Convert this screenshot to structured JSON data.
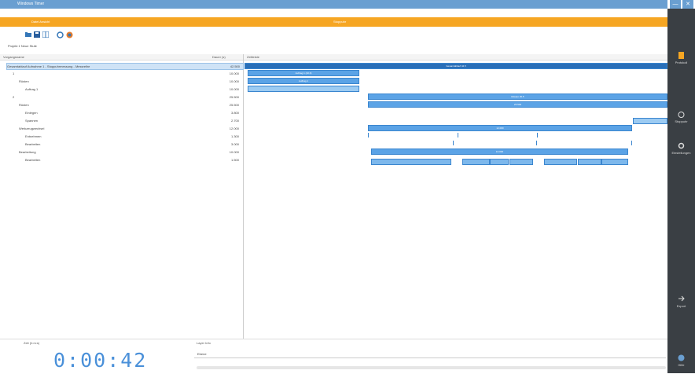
{
  "window": {
    "title": "Windows Timer",
    "minimize": "—",
    "close": "✕"
  },
  "menu": {
    "left": "Datei   Ansicht",
    "center": "Stoppuhr"
  },
  "toolbar": {
    "icons": [
      "open-icon",
      "save-icon",
      "grid-icon",
      "refresh-icon",
      "globe-icon"
    ]
  },
  "breadcrumb": "Projekt 1   Neue Stufe",
  "columns": {
    "name": "Vorgangsname",
    "duration": "Dauer (s)",
    "timeline": "Zeitleiste"
  },
  "rows": [
    {
      "name": "Gesamtablauf Aufnahme 1 - Stoppuhrmessung - Messreihe",
      "val": "42.500",
      "indent": 0,
      "selected": true
    },
    {
      "name": "1",
      "val": "10.000",
      "indent": 1
    },
    {
      "name": "Rüsten",
      "val": "10.000",
      "indent": 2
    },
    {
      "name": "Auftrag 1",
      "val": "10.000",
      "indent": 3
    },
    {
      "name": "2",
      "val": "25.500",
      "indent": 1
    },
    {
      "name": "Rüsten",
      "val": "25.500",
      "indent": 2
    },
    {
      "name": "Einlegen",
      "val": "3.800",
      "indent": 3
    },
    {
      "name": "Spannen",
      "val": "2.700",
      "indent": 3
    },
    {
      "name": "Werkzeugwechsel",
      "val": "12.000",
      "indent": 2
    },
    {
      "name": "Entnehmen",
      "val": "1.300",
      "indent": 3
    },
    {
      "name": "Bearbeiten",
      "val": "3.000",
      "indent": 3
    },
    {
      "name": "Bearbeitung",
      "val": "10.000",
      "indent": 2
    },
    {
      "name": "Bearbeiten",
      "val": "1.500",
      "indent": 3
    }
  ],
  "timeline": {
    "top_bar": "Gesamtablauf 42.5",
    "bars": [
      "Auftrag 1 (10.0)",
      "Auftrag 1",
      "Rüsten 25.5",
      "25.500",
      "12.000",
      "10.000"
    ]
  },
  "bottom": {
    "timer_label": "Zeit (h:m:s)",
    "timer": "0:00:42",
    "layer_label": "Layer Info",
    "layer_value": "Ebene"
  },
  "sidebar": [
    {
      "label": "Protokoll",
      "icon": "document-icon"
    },
    {
      "label": "Stoppuhr",
      "icon": "stopwatch-icon"
    },
    {
      "label": "Einstellungen",
      "icon": "gear-icon"
    },
    {
      "label": "Export",
      "icon": "export-icon"
    },
    {
      "label": "Hilfe",
      "icon": "help-icon"
    }
  ]
}
